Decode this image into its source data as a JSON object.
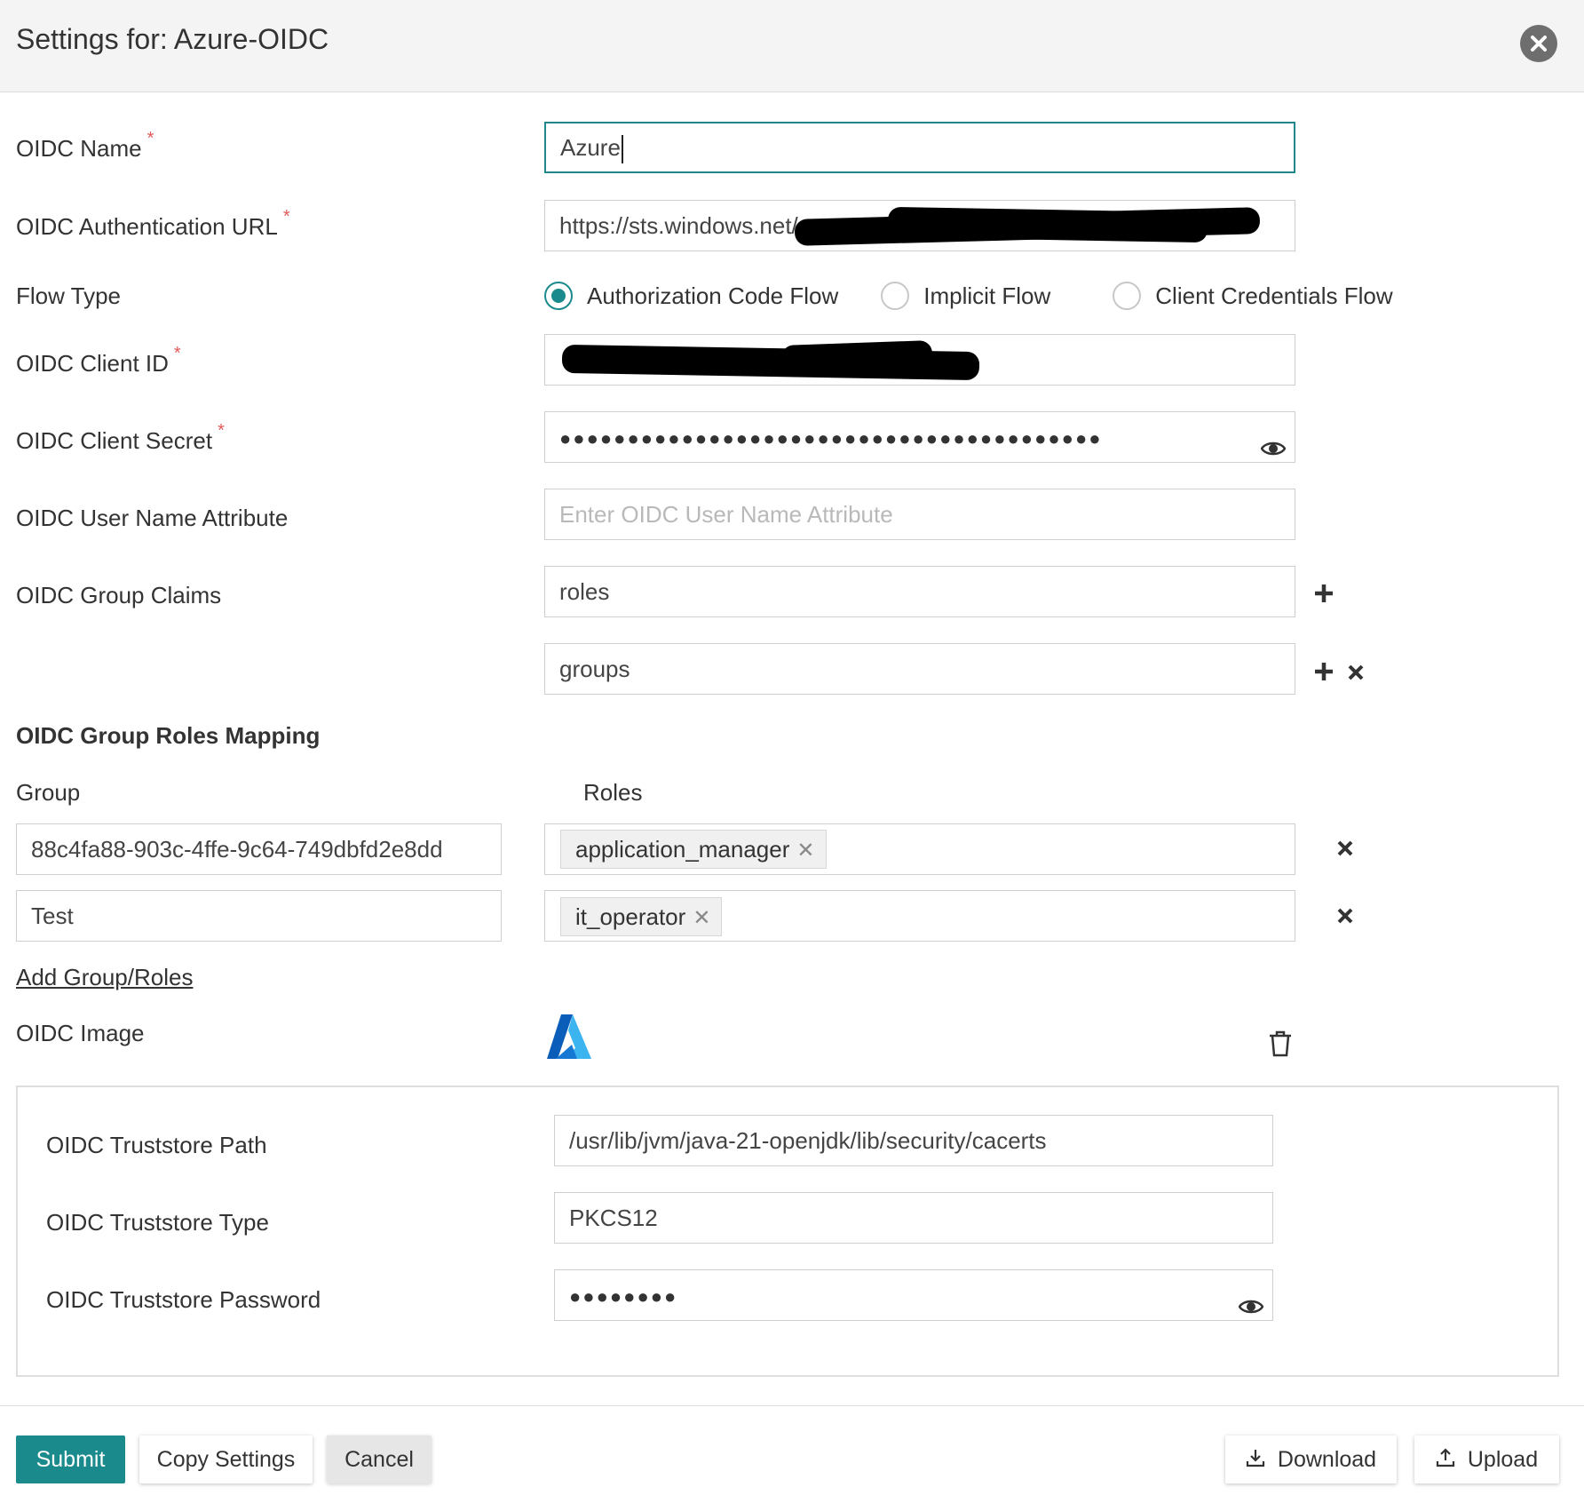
{
  "header": {
    "title": "Settings for: Azure-OIDC",
    "close_icon": "close-circle-icon"
  },
  "form": {
    "oidc_name": {
      "label": "OIDC Name",
      "required_mark": "*",
      "value": "Azure"
    },
    "auth_url": {
      "label": "OIDC Authentication URL",
      "required_mark": "*",
      "value": "https://sts.windows.net/"
    },
    "flow_type": {
      "label": "Flow Type",
      "options": [
        "Authorization Code Flow",
        "Implicit Flow",
        "Client Credentials Flow"
      ],
      "selected": "Authorization Code Flow"
    },
    "client_id": {
      "label": "OIDC Client ID",
      "required_mark": "*",
      "value": ""
    },
    "client_secret": {
      "label": "OIDC Client Secret",
      "required_mark": "*",
      "masked": "●●●●●●●●●●●●●●●●●●●●●●●●●●●●●●●●●●●●●●●●",
      "eye_icon": "eye-icon"
    },
    "user_name_attr": {
      "label": "OIDC User Name Attribute",
      "placeholder": "Enter OIDC User Name Attribute",
      "value": ""
    },
    "group_claims": {
      "label": "OIDC Group Claims",
      "values": [
        "roles",
        "groups"
      ]
    }
  },
  "mapping": {
    "title": "OIDC Group Roles Mapping",
    "group_header": "Group",
    "roles_header": "Roles",
    "rows": [
      {
        "group": "88c4fa88-903c-4ffe-9c64-749dbfd2e8dd",
        "role": "application_manager"
      },
      {
        "group": "Test",
        "role": "it_operator"
      }
    ],
    "add_link": "Add Group/Roles"
  },
  "image": {
    "label": "OIDC Image",
    "logo_icon": "azure-logo-icon",
    "delete_icon": "trash-icon"
  },
  "truststore": {
    "path": {
      "label": "OIDC Truststore Path",
      "value": "/usr/lib/jvm/java-21-openjdk/lib/security/cacerts"
    },
    "type": {
      "label": "OIDC Truststore Type",
      "value": "PKCS12"
    },
    "password": {
      "label": "OIDC Truststore Password",
      "masked": "●●●●●●●●"
    }
  },
  "footer": {
    "submit": "Submit",
    "copy": "Copy Settings",
    "cancel": "Cancel",
    "download": "Download",
    "upload": "Upload"
  },
  "colors": {
    "accent": "#1a8a8c",
    "required": "#e05a5a",
    "azure_dark": "#0a5db8",
    "azure_light": "#3cb4f0"
  }
}
